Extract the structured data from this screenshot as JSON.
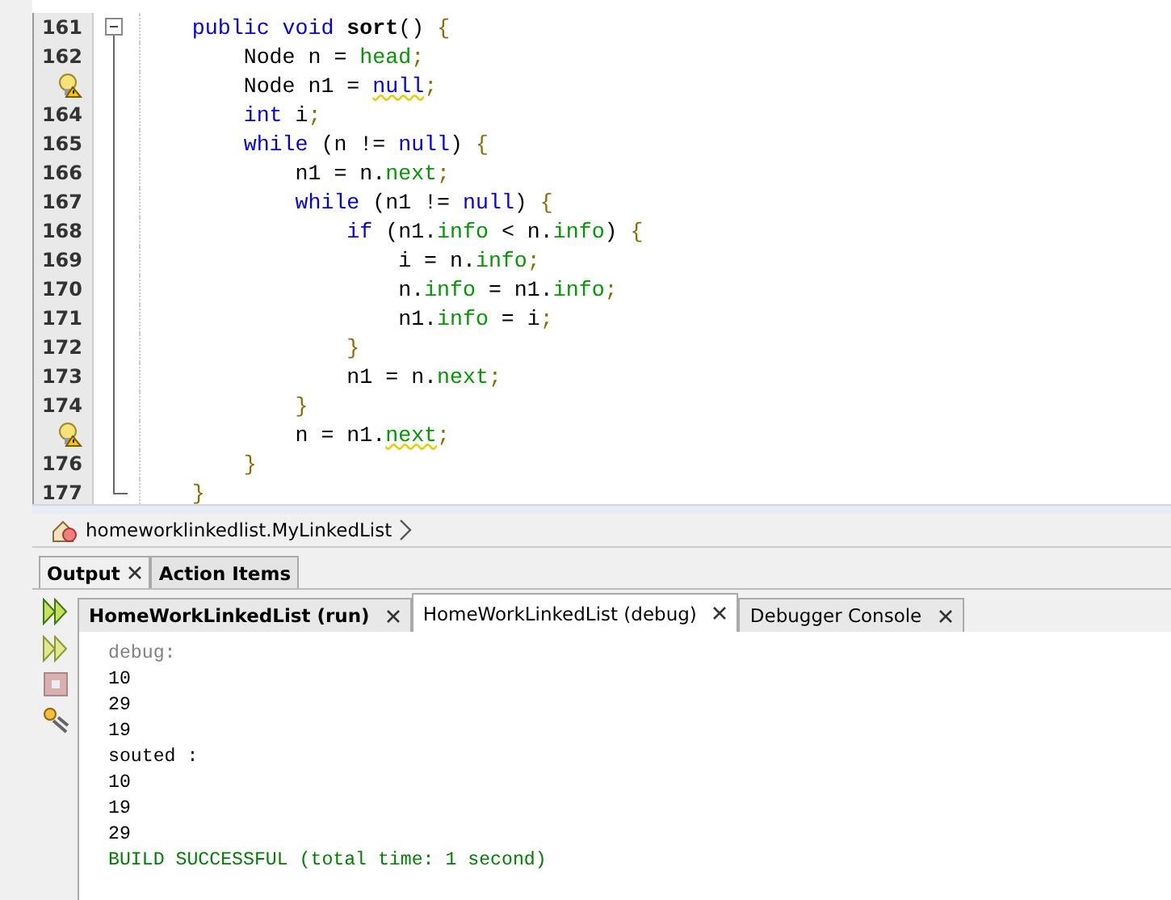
{
  "editor": {
    "fold_expanded": true,
    "lines": [
      {
        "number": "161",
        "kind": "number",
        "tokens": [
          {
            "t": "    public void",
            "kind": "kw"
          },
          {
            "t": " sort",
            "kind": "bold"
          },
          {
            "t": "() ",
            "kind": "plain"
          },
          {
            "t": "{",
            "kind": "punct"
          }
        ]
      },
      {
        "number": "162",
        "kind": "number",
        "tokens": [
          {
            "t": "        Node n = ",
            "kind": "plain"
          },
          {
            "t": "head",
            "kind": "field"
          },
          {
            "t": ";",
            "kind": "punct"
          }
        ]
      },
      {
        "kind": "hint",
        "tokens": [
          {
            "t": "        Node n1 = ",
            "kind": "plain"
          },
          {
            "t": "null",
            "kind": "kw",
            "warning": true
          },
          {
            "t": ";",
            "kind": "punct"
          }
        ]
      },
      {
        "number": "164",
        "kind": "number",
        "tokens": [
          {
            "t": "        int",
            "kind": "kw"
          },
          {
            "t": " i",
            "kind": "plain"
          },
          {
            "t": ";",
            "kind": "punct"
          }
        ]
      },
      {
        "number": "165",
        "kind": "number",
        "tokens": [
          {
            "t": "        while",
            "kind": "kw"
          },
          {
            "t": " (n != ",
            "kind": "plain"
          },
          {
            "t": "null",
            "kind": "kw"
          },
          {
            "t": ") ",
            "kind": "plain"
          },
          {
            "t": "{",
            "kind": "punct"
          }
        ]
      },
      {
        "number": "166",
        "kind": "number",
        "tokens": [
          {
            "t": "            n1 = n.",
            "kind": "plain"
          },
          {
            "t": "next",
            "kind": "field"
          },
          {
            "t": ";",
            "kind": "punct"
          }
        ]
      },
      {
        "number": "167",
        "kind": "number",
        "tokens": [
          {
            "t": "            while",
            "kind": "kw"
          },
          {
            "t": " (n1 != ",
            "kind": "plain"
          },
          {
            "t": "null",
            "kind": "kw"
          },
          {
            "t": ") ",
            "kind": "plain"
          },
          {
            "t": "{",
            "kind": "punct"
          }
        ]
      },
      {
        "number": "168",
        "kind": "number",
        "tokens": [
          {
            "t": "                if",
            "kind": "kw"
          },
          {
            "t": " (n1.",
            "kind": "plain"
          },
          {
            "t": "info",
            "kind": "field"
          },
          {
            "t": " < n.",
            "kind": "plain"
          },
          {
            "t": "info",
            "kind": "field"
          },
          {
            "t": ") ",
            "kind": "plain"
          },
          {
            "t": "{",
            "kind": "punct"
          }
        ]
      },
      {
        "number": "169",
        "kind": "number",
        "tokens": [
          {
            "t": "                    i = n.",
            "kind": "plain"
          },
          {
            "t": "info",
            "kind": "field"
          },
          {
            "t": ";",
            "kind": "punct"
          }
        ]
      },
      {
        "number": "170",
        "kind": "number",
        "tokens": [
          {
            "t": "                    n.",
            "kind": "plain"
          },
          {
            "t": "info",
            "kind": "field"
          },
          {
            "t": " = n1.",
            "kind": "plain"
          },
          {
            "t": "info",
            "kind": "field"
          },
          {
            "t": ";",
            "kind": "punct"
          }
        ]
      },
      {
        "number": "171",
        "kind": "number",
        "tokens": [
          {
            "t": "                    n1.",
            "kind": "plain"
          },
          {
            "t": "info",
            "kind": "field"
          },
          {
            "t": " = i",
            "kind": "plain"
          },
          {
            "t": ";",
            "kind": "punct"
          }
        ]
      },
      {
        "number": "172",
        "kind": "number",
        "tokens": [
          {
            "t": "                }",
            "kind": "punct"
          }
        ]
      },
      {
        "number": "173",
        "kind": "number",
        "tokens": [
          {
            "t": "                n1 = n.",
            "kind": "plain"
          },
          {
            "t": "next",
            "kind": "field"
          },
          {
            "t": ";",
            "kind": "punct"
          }
        ]
      },
      {
        "number": "174",
        "kind": "number",
        "tokens": [
          {
            "t": "            }",
            "kind": "punct"
          }
        ]
      },
      {
        "kind": "hint",
        "tokens": [
          {
            "t": "            n = n1.",
            "kind": "plain"
          },
          {
            "t": "next",
            "kind": "field",
            "warning": true
          },
          {
            "t": ";",
            "kind": "punct"
          }
        ]
      },
      {
        "number": "176",
        "kind": "number",
        "tokens": [
          {
            "t": "        }",
            "kind": "punct"
          }
        ]
      },
      {
        "number": "177",
        "kind": "number",
        "tokens": [
          {
            "t": "    }",
            "kind": "punct"
          }
        ]
      }
    ]
  },
  "breadcrumb": {
    "path": "homeworklinkedlist.MyLinkedList"
  },
  "panel_tabs": [
    {
      "label": "Output",
      "selected": true,
      "closable": true
    },
    {
      "label": "Action Items",
      "selected": false,
      "closable": false
    }
  ],
  "output_tabs": [
    {
      "label": "HomeWorkLinkedList (run)",
      "selected": false,
      "bold": true
    },
    {
      "label": "HomeWorkLinkedList (debug)",
      "selected": true,
      "bold": false
    },
    {
      "label": "Debugger Console",
      "selected": false,
      "bold": false
    }
  ],
  "output_lines": [
    {
      "text": "debug:",
      "kind": "muted"
    },
    {
      "text": "10",
      "kind": "normal"
    },
    {
      "text": "29",
      "kind": "normal"
    },
    {
      "text": "19",
      "kind": "normal"
    },
    {
      "text": "souted :",
      "kind": "normal"
    },
    {
      "text": "10",
      "kind": "normal"
    },
    {
      "text": "19",
      "kind": "normal"
    },
    {
      "text": "29",
      "kind": "normal"
    },
    {
      "text": "BUILD SUCCESSFUL (total time: 1 second)",
      "kind": "success"
    }
  ]
}
